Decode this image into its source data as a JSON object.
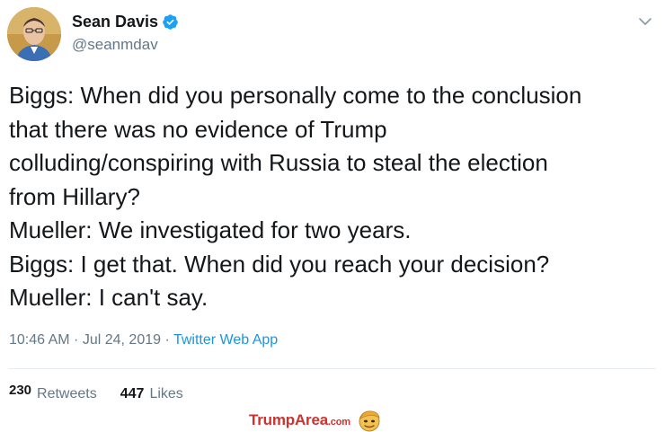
{
  "author": {
    "display_name": "Sean Davis",
    "handle": "@seanmdav",
    "verified": true
  },
  "menu": {
    "icon": "chevron-down-icon"
  },
  "tweet": {
    "lines": [
      "Biggs: When did you personally come to the conclusion",
      "that there was no evidence of Trump",
      "colluding/conspiring with Russia to steal the election",
      "from Hillary?",
      "Mueller: We investigated for two years.",
      "Biggs: I get that. When did you reach your decision?",
      "Mueller: I can't say."
    ]
  },
  "meta": {
    "time": "10:46 AM",
    "separator1": " · ",
    "date": "Jul 24, 2019",
    "separator2": " · ",
    "source": "Twitter Web App"
  },
  "stats": {
    "retweets_count": "230",
    "retweets_label": "Retweets",
    "likes_count": "447",
    "likes_label": "Likes"
  },
  "watermark": {
    "text": "TrumpArea",
    "suffix": ".com"
  },
  "colors": {
    "link": "#1b95e0",
    "verified": "#1da1f2",
    "watermark": "#d2302c"
  }
}
